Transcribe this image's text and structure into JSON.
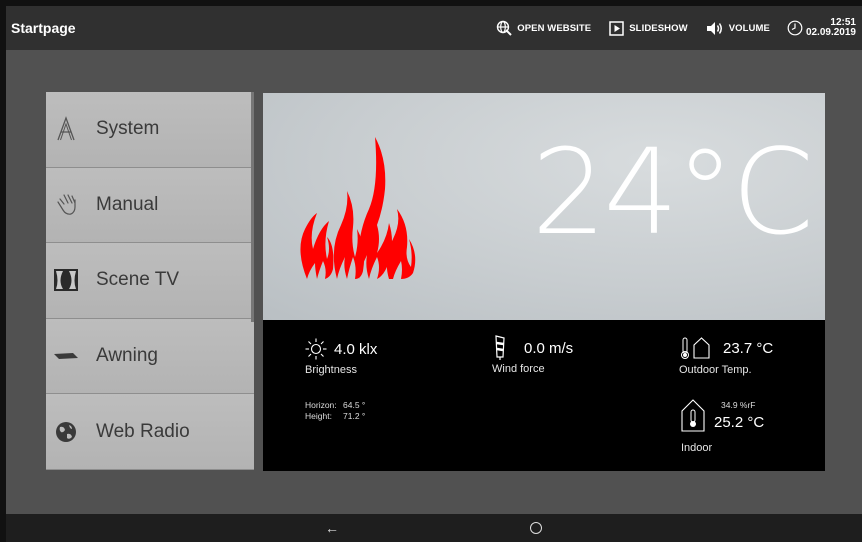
{
  "header": {
    "title": "Startpage",
    "open_website": "OPEN WEBSITE",
    "slideshow": "SLIDESHOW",
    "volume": "VOLUME",
    "time": "12:51",
    "date": "02.09.2019"
  },
  "menu": {
    "items": [
      {
        "label": "System",
        "icon": "system-icon"
      },
      {
        "label": "Manual",
        "icon": "hand-icon"
      },
      {
        "label": "Scene TV",
        "icon": "curtain-icon"
      },
      {
        "label": "Awning",
        "icon": "awning-icon"
      },
      {
        "label": "Web Radio",
        "icon": "globe-icon"
      }
    ]
  },
  "hero": {
    "temperature": "24°C",
    "icon": "fire-icon",
    "colors": {
      "flame": "#ff0000"
    }
  },
  "weather": {
    "brightness": {
      "value": "4.0 klx",
      "label": "Brightness"
    },
    "wind": {
      "value": "0.0 m/s",
      "label": "Wind force"
    },
    "outdoor": {
      "value": "23.7 °C",
      "label": "Outdoor Temp."
    },
    "sun": {
      "horizon_label": "Horizon:",
      "horizon_value": "64.5 °",
      "height_label": "Height:",
      "height_value": "71.2 °"
    },
    "indoor": {
      "humidity": "34.9 %rF",
      "value": "25.2 °C",
      "label": "Indoor"
    }
  },
  "nav": {
    "back": "←"
  }
}
